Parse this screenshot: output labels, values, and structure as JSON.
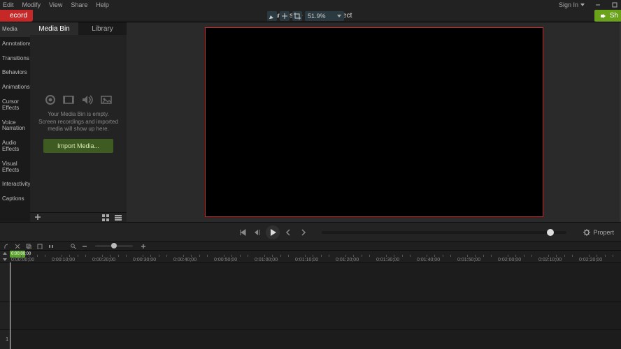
{
  "menu": {
    "items": [
      "Edit",
      "Modify",
      "View",
      "Share",
      "Help"
    ],
    "signin": "Sign In"
  },
  "titlebar": {
    "record": "ecord",
    "title": "Camtasia - Untitled Project",
    "zoom": "51.9%",
    "share": "Sh"
  },
  "sidebar": {
    "items": [
      "Media",
      "Annotations",
      "Transitions",
      "Behaviors",
      "Animations",
      "Cursor Effects",
      "Voice Narration",
      "Audio Effects",
      "Visual Effects",
      "Interactivity",
      "Captions"
    ],
    "active_index": 0
  },
  "panel": {
    "tabs": [
      "Media Bin",
      "Library"
    ],
    "active_tab": 0,
    "empty_line1": "Your Media Bin is empty.",
    "empty_line2": "Screen recordings and imported",
    "empty_line3": "media will show up here.",
    "import_label": "Import Media..."
  },
  "playback": {
    "properties_label": "Propert"
  },
  "timeline": {
    "current_time": "0:00:00;00",
    "ticks": [
      "0:00:00;00",
      "0:00:10;00",
      "0:00:20;00",
      "0:00:30;00",
      "0:00:40;00",
      "0:00:50;00",
      "0:01:00;00",
      "0:01:10;00",
      "0:01:20;00",
      "0:01:30;00",
      "0:01:40;00",
      "0:01:50;00",
      "0:02:00;00",
      "0:02:10;00",
      "0:02:20;00"
    ],
    "track_label": "1"
  },
  "colors": {
    "accent_green": "#6aa31a",
    "accent_red": "#c62828"
  }
}
